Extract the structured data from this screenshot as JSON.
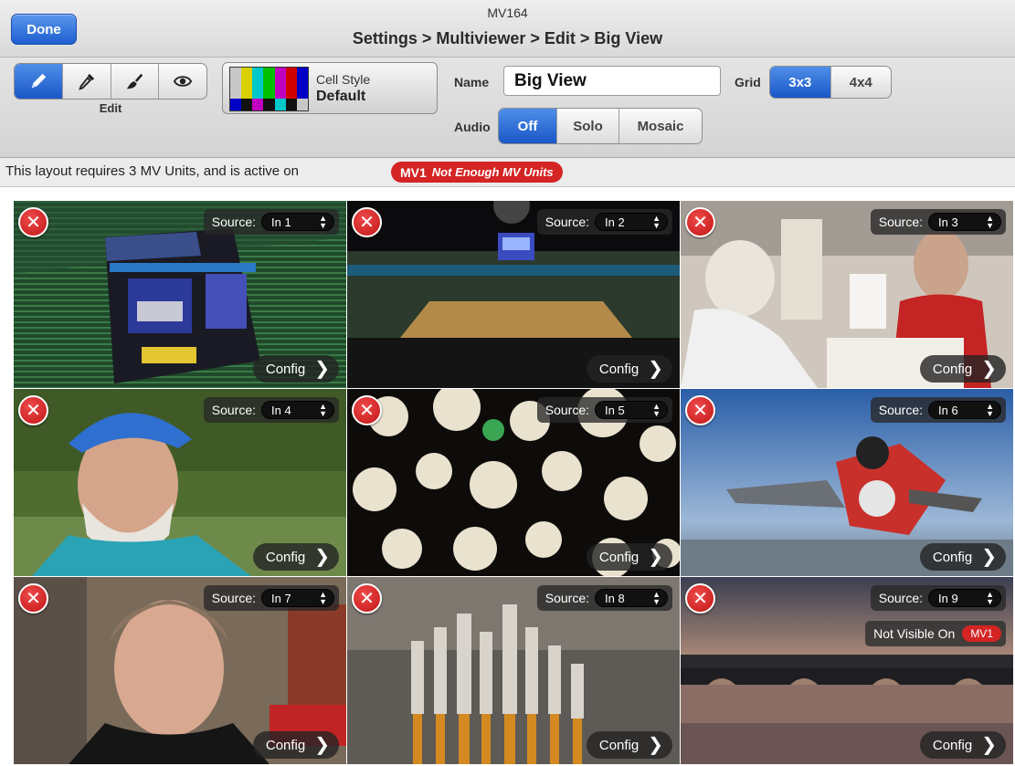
{
  "header": {
    "device": "MV164",
    "breadcrumb": "Settings > Multiviewer > Edit > Big View",
    "done_label": "Done"
  },
  "toolbar": {
    "edit_tools": [
      {
        "icon": "pencil-icon",
        "selected": true
      },
      {
        "icon": "eyedropper-icon",
        "selected": false
      },
      {
        "icon": "brush-icon",
        "selected": false
      },
      {
        "icon": "eye-icon",
        "selected": false
      }
    ],
    "edit_label": "Edit",
    "cell_style": {
      "title": "Cell Style",
      "value": "Default"
    },
    "name_label": "Name",
    "name_value": "Big View",
    "grid_label": "Grid",
    "grid_options": [
      "3x3",
      "4x4"
    ],
    "grid_selected": "3x3",
    "audio_label": "Audio",
    "audio_options": [
      "Off",
      "Solo",
      "Mosaic"
    ],
    "audio_selected": "Off"
  },
  "status": {
    "text": "This layout requires 3 MV Units, and is active on",
    "unit": "MV1",
    "warning": "Not Enough MV Units"
  },
  "cells": [
    {
      "source_label": "Source:",
      "source": "In 1",
      "config": "Config",
      "scene": "arena-scoreboard",
      "not_visible": null
    },
    {
      "source_label": "Source:",
      "source": "In 2",
      "config": "Config",
      "scene": "basketball-arena",
      "not_visible": null
    },
    {
      "source_label": "Source:",
      "source": "In 3",
      "config": "Config",
      "scene": "diner",
      "not_visible": null
    },
    {
      "source_label": "Source:",
      "source": "In 4",
      "config": "Config",
      "scene": "man-blue-cap",
      "not_visible": null
    },
    {
      "source_label": "Source:",
      "source": "In 5",
      "config": "Config",
      "scene": "lanterns",
      "not_visible": null
    },
    {
      "source_label": "Source:",
      "source": "In 6",
      "config": "Config",
      "scene": "skydivers",
      "not_visible": null
    },
    {
      "source_label": "Source:",
      "source": "In 7",
      "config": "Config",
      "scene": "man-portrait",
      "not_visible": null
    },
    {
      "source_label": "Source:",
      "source": "In 8",
      "config": "Config",
      "scene": "incense",
      "not_visible": null
    },
    {
      "source_label": "Source:",
      "source": "In 9",
      "config": "Config",
      "scene": "river-bridge-sunset",
      "not_visible": {
        "label": "Not Visible On",
        "unit": "MV1"
      }
    }
  ],
  "colors": {
    "accent": "#1a56c8",
    "alert": "#d42424"
  }
}
